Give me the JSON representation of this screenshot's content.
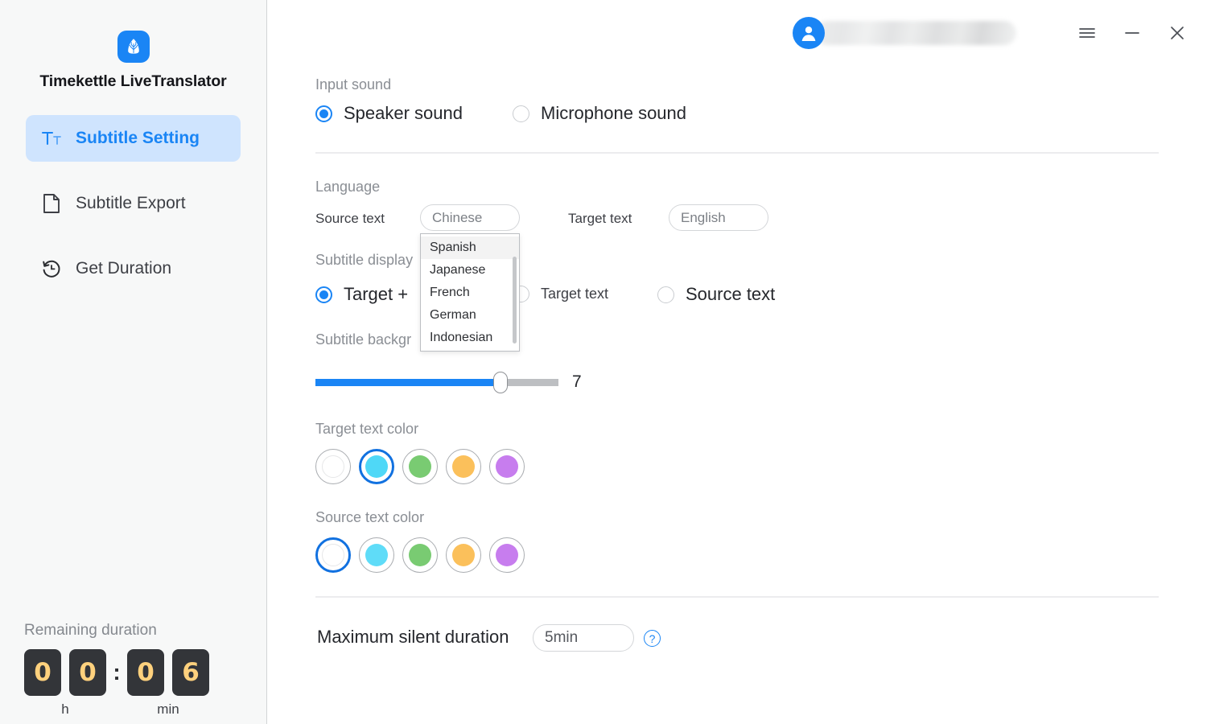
{
  "app": {
    "name": "Timekettle LiveTranslator",
    "logo_icon": "tree-logo-icon",
    "accent_color": "#1a85f5"
  },
  "sidebar": {
    "items": [
      {
        "label": "Subtitle Setting",
        "icon": "text-format-icon",
        "active": true
      },
      {
        "label": "Subtitle Export",
        "icon": "file-export-icon",
        "active": false
      },
      {
        "label": "Get Duration",
        "icon": "clock-refresh-icon",
        "active": false
      }
    ],
    "duration": {
      "title": "Remaining duration",
      "hours": [
        "0",
        "0"
      ],
      "minutes": [
        "0",
        "6"
      ],
      "separator": ":",
      "hours_unit": "h",
      "minutes_unit": "min"
    }
  },
  "titlebar": {
    "avatar_icon": "user-avatar-icon",
    "username": "",
    "menu_icon": "hamburger-menu-icon",
    "minimize_icon": "minimize-icon",
    "close_icon": "close-icon"
  },
  "main": {
    "input_sound": {
      "label": "Input sound",
      "options": [
        {
          "label": "Speaker sound",
          "selected": true
        },
        {
          "label": "Microphone sound",
          "selected": false
        }
      ]
    },
    "language": {
      "label": "Language",
      "source_label": "Source text",
      "source_value": "Chinese",
      "target_label": "Target text",
      "target_value": "English",
      "dropdown_open": true,
      "dropdown_options": [
        {
          "label": "Spanish",
          "highlighted": true
        },
        {
          "label": "Japanese",
          "highlighted": false
        },
        {
          "label": "French",
          "highlighted": false
        },
        {
          "label": "German",
          "highlighted": false
        },
        {
          "label": "Indonesian",
          "highlighted": false
        }
      ]
    },
    "subtitle_display": {
      "label": "Subtitle display",
      "options": [
        {
          "label": "Target +",
          "selected": true
        },
        {
          "label": "Target text",
          "selected": false
        },
        {
          "label": "Source text",
          "selected": false
        }
      ]
    },
    "subtitle_background": {
      "label": "Subtitle backgr",
      "value": "7",
      "percent": 76
    },
    "target_text_color": {
      "label": "Target text color",
      "colors": [
        "#ffffff",
        "#4fd8f7",
        "#79cb72",
        "#fbc05b",
        "#c77dee"
      ],
      "selected_index": 1
    },
    "source_text_color": {
      "label": "Source text color",
      "colors": [
        "#ffffff",
        "#5fdcf8",
        "#79cb72",
        "#fbc05b",
        "#c77dee"
      ],
      "selected_index": 0
    },
    "maximum_silent_duration": {
      "label": "Maximum silent duration",
      "value": "5min",
      "help_icon": "question-mark-icon",
      "help_glyph": "?"
    }
  }
}
